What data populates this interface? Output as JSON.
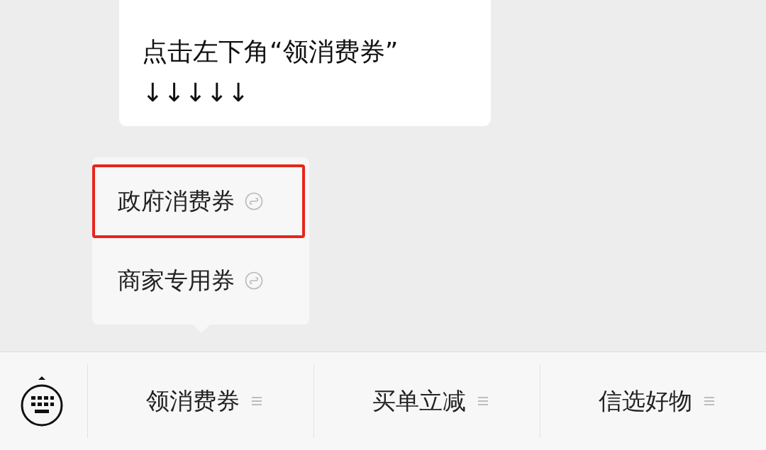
{
  "message": {
    "lines": [
      "点击左下角“领消费券”",
      "↓↓↓↓↓"
    ]
  },
  "menu": {
    "items": [
      {
        "label": "政府消费券",
        "highlighted": true
      },
      {
        "label": "商家专用券",
        "highlighted": false
      }
    ]
  },
  "bottom_menu": {
    "items": [
      {
        "label": "领消费券"
      },
      {
        "label": "买单立减"
      },
      {
        "label": "信选好物"
      }
    ]
  }
}
